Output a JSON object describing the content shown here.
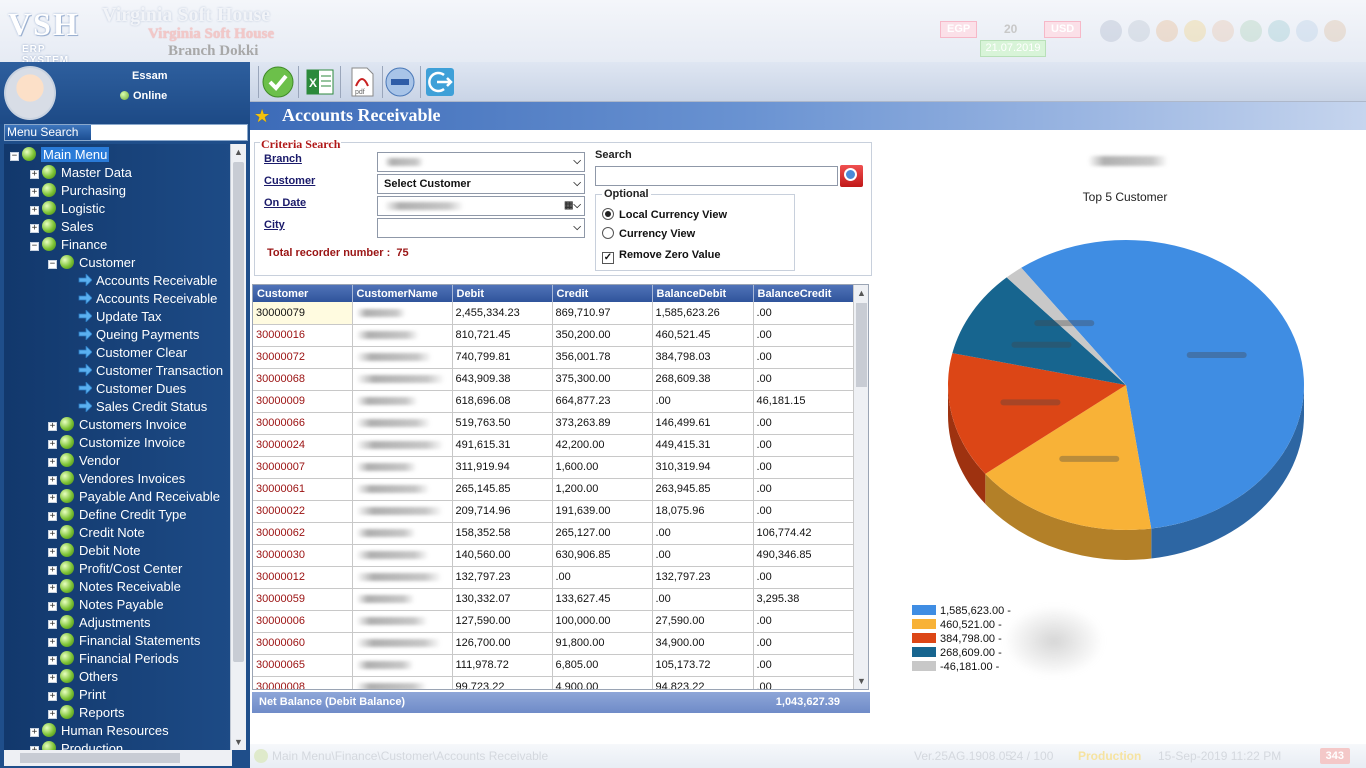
{
  "header": {
    "logo_text": "VSH",
    "logo_sub": "ERP SYSTEM",
    "company_name": "Virginia Soft House",
    "company_name_sub": "Virginia Soft House",
    "branch": "Branch Dokki",
    "currency_local": "EGP",
    "rate": "20",
    "currency_foreign": "USD",
    "date": "21.07.2019"
  },
  "user": {
    "name": "Essam",
    "status": "Online"
  },
  "menu_search": {
    "label": "Menu Search",
    "value": ""
  },
  "tree": [
    {
      "label": "Main Menu",
      "level": 0,
      "kind": "ball",
      "expander": "-",
      "selected": true
    },
    {
      "label": "Master Data",
      "level": 1,
      "kind": "ball",
      "expander": "+"
    },
    {
      "label": "Purchasing",
      "level": 1,
      "kind": "ball",
      "expander": "+"
    },
    {
      "label": "Logistic",
      "level": 1,
      "kind": "ball",
      "expander": "+"
    },
    {
      "label": "Sales",
      "level": 1,
      "kind": "ball",
      "expander": "+"
    },
    {
      "label": "Finance",
      "level": 1,
      "kind": "ball",
      "expander": "-"
    },
    {
      "label": "Customer",
      "level": 2,
      "kind": "ball",
      "expander": "-"
    },
    {
      "label": "Accounts Receivable",
      "level": 3,
      "kind": "arrow"
    },
    {
      "label": "Accounts Receivable",
      "level": 3,
      "kind": "arrow"
    },
    {
      "label": "Update Tax",
      "level": 3,
      "kind": "arrow"
    },
    {
      "label": "Queing Payments",
      "level": 3,
      "kind": "arrow"
    },
    {
      "label": "Customer Clear",
      "level": 3,
      "kind": "arrow"
    },
    {
      "label": "Customer Transaction",
      "level": 3,
      "kind": "arrow"
    },
    {
      "label": "Customer Dues",
      "level": 3,
      "kind": "arrow"
    },
    {
      "label": "Sales Credit Status",
      "level": 3,
      "kind": "arrow"
    },
    {
      "label": "Customers Invoice",
      "level": 2,
      "kind": "ball",
      "expander": "+"
    },
    {
      "label": "Customize Invoice",
      "level": 2,
      "kind": "ball",
      "expander": "+"
    },
    {
      "label": "Vendor",
      "level": 2,
      "kind": "ball",
      "expander": "+"
    },
    {
      "label": "Vendores Invoices",
      "level": 2,
      "kind": "ball",
      "expander": "+"
    },
    {
      "label": "Payable And Receivable",
      "level": 2,
      "kind": "ball",
      "expander": "+"
    },
    {
      "label": "Define Credit Type",
      "level": 2,
      "kind": "ball",
      "expander": "+"
    },
    {
      "label": "Credit Note",
      "level": 2,
      "kind": "ball",
      "expander": "+"
    },
    {
      "label": "Debit Note",
      "level": 2,
      "kind": "ball",
      "expander": "+"
    },
    {
      "label": "Profit/Cost Center",
      "level": 2,
      "kind": "ball",
      "expander": "+"
    },
    {
      "label": "Notes Receivable",
      "level": 2,
      "kind": "ball",
      "expander": "+"
    },
    {
      "label": "Notes Payable",
      "level": 2,
      "kind": "ball",
      "expander": "+"
    },
    {
      "label": "Adjustments",
      "level": 2,
      "kind": "ball",
      "expander": "+"
    },
    {
      "label": "Financial Statements",
      "level": 2,
      "kind": "ball",
      "expander": "+"
    },
    {
      "label": "Financial Periods",
      "level": 2,
      "kind": "ball",
      "expander": "+"
    },
    {
      "label": "Others",
      "level": 2,
      "kind": "ball",
      "expander": "+"
    },
    {
      "label": "Print",
      "level": 2,
      "kind": "ball",
      "expander": "+"
    },
    {
      "label": "Reports",
      "level": 2,
      "kind": "ball",
      "expander": "+"
    },
    {
      "label": "Human Resources",
      "level": 1,
      "kind": "ball",
      "expander": "+"
    },
    {
      "label": "Production",
      "level": 1,
      "kind": "ball",
      "expander": "+"
    }
  ],
  "toolbar": [
    "check-icon",
    "excel-icon",
    "pdf-icon",
    "minus-icon",
    "exit-icon"
  ],
  "page_title": "Accounts Receivable",
  "criteria": {
    "legend": "Criteria Search",
    "branch_label": "Branch",
    "customer_label": "Customer",
    "customer_value": "Select Customer",
    "date_label": "On Date",
    "city_label": "City",
    "total_label": "Total recorder number :",
    "total_value": "75",
    "search_label": "Search",
    "search_value": "",
    "optional_label": "Optional",
    "opt_local": "Local Currency View",
    "opt_currency": "Currency View",
    "opt_remove_zero": "Remove Zero Value"
  },
  "grid": {
    "columns": [
      "Customer",
      "CustomerName",
      "Debit",
      "Credit",
      "BalanceDebit",
      "BalanceCredit"
    ],
    "rows": [
      [
        "30000079",
        "",
        "2,455,334.23",
        "869,710.97",
        "1,585,623.26",
        ".00"
      ],
      [
        "30000016",
        "",
        "810,721.45",
        "350,200.00",
        "460,521.45",
        ".00"
      ],
      [
        "30000072",
        "",
        "740,799.81",
        "356,001.78",
        "384,798.03",
        ".00"
      ],
      [
        "30000068",
        "",
        "643,909.38",
        "375,300.00",
        "268,609.38",
        ".00"
      ],
      [
        "30000009",
        "",
        "618,696.08",
        "664,877.23",
        ".00",
        "46,181.15"
      ],
      [
        "30000066",
        "",
        "519,763.50",
        "373,263.89",
        "146,499.61",
        ".00"
      ],
      [
        "30000024",
        "",
        "491,615.31",
        "42,200.00",
        "449,415.31",
        ".00"
      ],
      [
        "30000007",
        "",
        "311,919.94",
        "1,600.00",
        "310,319.94",
        ".00"
      ],
      [
        "30000061",
        "",
        "265,145.85",
        "1,200.00",
        "263,945.85",
        ".00"
      ],
      [
        "30000022",
        "",
        "209,714.96",
        "191,639.00",
        "18,075.96",
        ".00"
      ],
      [
        "30000062",
        "",
        "158,352.58",
        "265,127.00",
        ".00",
        "106,774.42"
      ],
      [
        "30000030",
        "",
        "140,560.00",
        "630,906.85",
        ".00",
        "490,346.85"
      ],
      [
        "30000012",
        "",
        "132,797.23",
        ".00",
        "132,797.23",
        ".00"
      ],
      [
        "30000059",
        "",
        "130,332.07",
        "133,627.45",
        ".00",
        "3,295.38"
      ],
      [
        "30000006",
        "",
        "127,590.00",
        "100,000.00",
        "27,590.00",
        ".00"
      ],
      [
        "30000060",
        "",
        "126,700.00",
        "91,800.00",
        "34,900.00",
        ".00"
      ],
      [
        "30000065",
        "",
        "111,978.72",
        "6,805.00",
        "105,173.72",
        ".00"
      ],
      [
        "30000008",
        "",
        "99,723.22",
        "4,900.00",
        "94,823.22",
        ".00"
      ]
    ]
  },
  "net_balance": {
    "label": "Net Balance  (Debit Balance)",
    "value": "1,043,627.39"
  },
  "chart_data": {
    "type": "pie",
    "title": "",
    "subtitle": "Top 5 Customer",
    "values": [
      1585623,
      460521,
      384798,
      268609,
      -46181
    ],
    "legend_labels": [
      "1,585,623.00 -",
      "460,521.00 -",
      "384,798.00 -",
      "268,609.00 -",
      "-46,181.00 -"
    ],
    "colors": [
      "#3f8de3",
      "#f8b237",
      "#dc4616",
      "#17658f",
      "#c8c8c8"
    ],
    "legend_placement": "bottom-left"
  },
  "statusbar": {
    "path": "Main Menu\\Finance\\Customer\\Accounts Receivable",
    "version": "Ver.25AG.1908.05",
    "count": "24 / 100",
    "mode": "Production",
    "datetime": "15-Sep-2019 11:22 PM",
    "badge": "343"
  }
}
